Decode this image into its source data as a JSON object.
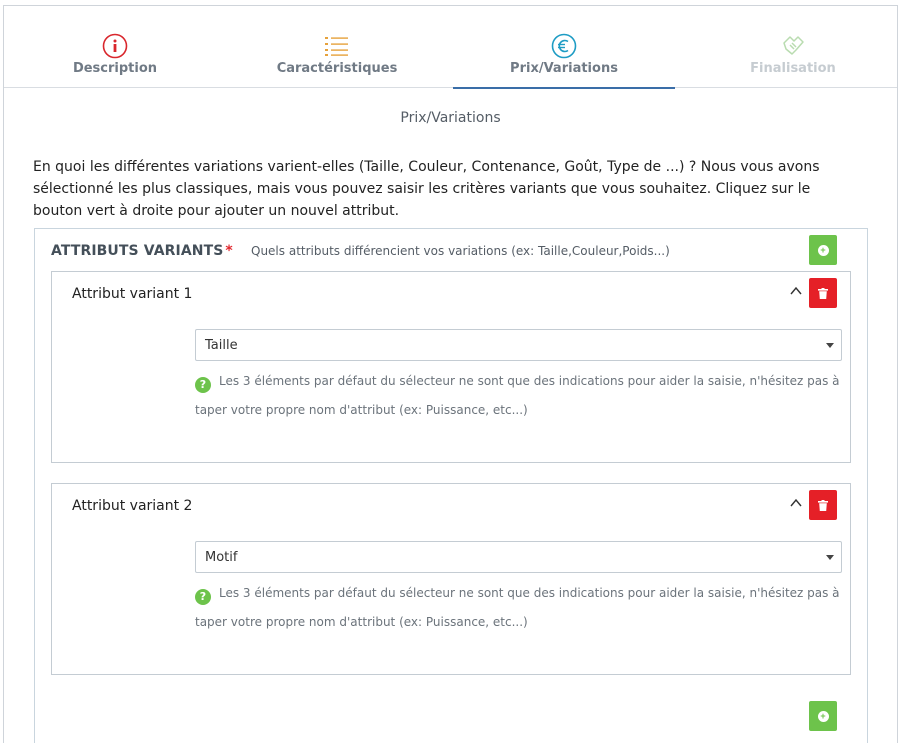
{
  "tabs": [
    {
      "label": "Description",
      "icon": "info-circle-icon",
      "state": "done"
    },
    {
      "label": "Caractéristiques",
      "icon": "list-icon",
      "state": "done"
    },
    {
      "label": "Prix/Variations",
      "icon": "euro-icon",
      "state": "active"
    },
    {
      "label": "Finalisation",
      "icon": "handshake-icon",
      "state": "disabled"
    }
  ],
  "page": {
    "subtitle": "Prix/Variations",
    "intro": "En quoi les différentes variations varient-elles (Taille, Couleur, Contenance, Goût, Type de ...) ? Nous vous avons sélectionné les plus classiques, mais vous pouvez saisir les critères variants que vous souhaitez. Cliquez sur le bouton vert à droite pour ajouter un nouvel attribut."
  },
  "panel": {
    "title": "ATTRIBUTS VARIANTS",
    "required_mark": "*",
    "hint": "Quels attributs différencient vos variations (ex: Taille,Couleur,Poids...)"
  },
  "attributes": [
    {
      "title": "Attribut variant 1",
      "value": "Taille",
      "help": "Les 3 éléments par défaut du sélecteur ne sont que des indications pour aider la saisie, n'hésitez pas à taper votre propre nom d'attribut (ex: Puissance, etc...)"
    },
    {
      "title": "Attribut variant 2",
      "value": "Motif",
      "help": "Les 3 éléments par défaut du sélecteur ne sont que des indications pour aider la saisie, n'hésitez pas à taper votre propre nom d'attribut (ex: Puissance, etc...)"
    }
  ],
  "colors": {
    "accent": "#3a6ea8",
    "green": "#6dc34b",
    "red": "#e52027",
    "tab_info": "#d9262c",
    "tab_list": "#e6a23c",
    "tab_euro": "#1e9cc4",
    "tab_disabled": "#b9dcb0"
  }
}
